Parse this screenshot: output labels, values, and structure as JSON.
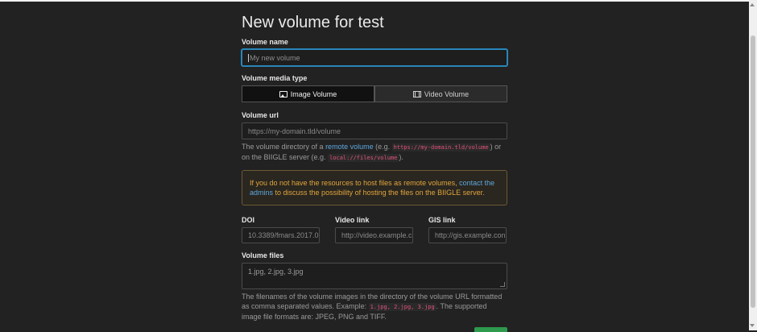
{
  "page": {
    "title": "New volume for test"
  },
  "volume_name": {
    "label": "Volume name",
    "placeholder": "My new volume"
  },
  "media_type": {
    "label": "Volume media type",
    "options": [
      {
        "label": "Image Volume",
        "icon": "image-icon",
        "selected": true
      },
      {
        "label": "Video Volume",
        "icon": "film-icon",
        "selected": false
      }
    ]
  },
  "volume_url": {
    "label": "Volume url",
    "placeholder": "https://my-domain.tld/volume",
    "help_text_1": "The volume directory of a",
    "help_link": "remote volume",
    "help_text_2": "(e.g.",
    "help_code_1": "https://my-domain.tld/volume",
    "help_text_3": ") or on the BIIGLE server (e.g.",
    "help_code_2": "local://files/volume",
    "help_text_4": ")."
  },
  "alert": {
    "text_1": "If you do not have the resources to host files as remote volumes,",
    "link": "contact the admins",
    "text_2": "to discuss the possibility of hosting the files on the BIIGLE server."
  },
  "doi": {
    "label": "DOI",
    "placeholder": "10.3389/fmars.2017.0"
  },
  "video_link": {
    "label": "Video link",
    "placeholder": "http://video.example.c"
  },
  "gis_link": {
    "label": "GIS link",
    "placeholder": "http://gis.example.con"
  },
  "volume_files": {
    "label": "Volume files",
    "placeholder": "1.jpg, 2.jpg, 3.jpg",
    "help_text_1": "The filenames of the volume images in the directory of the volume URL formatted as comma separated values. Example:",
    "help_code": "1.jpg, 2.jpg, 3.jpg",
    "help_text_2": ". The supported image file formats are: JPEG, PNG and TIFF."
  },
  "colors": {
    "background": "#222222",
    "accent": "#2a85b9",
    "link": "#5ea8dd",
    "warning": "#e0a63c",
    "submit": "#2d9a4d"
  }
}
